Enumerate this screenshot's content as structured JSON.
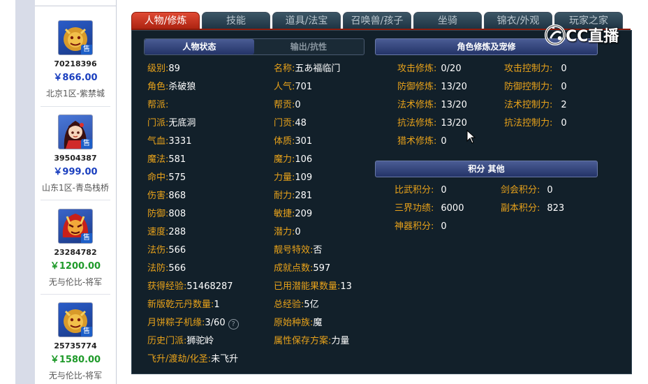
{
  "listings": [
    {
      "id": "70218396",
      "price": "￥866.00",
      "price_color": "#1a3fbf",
      "server": "北京1区-紫禁城",
      "sale_label": "售",
      "avatar": "lion-monster-avatar"
    },
    {
      "id": "39504387",
      "price": "￥999.00",
      "price_color": "#1a3fbf",
      "server": "山东1区-青岛栈桥",
      "sale_label": "售",
      "avatar": "girl-character-avatar"
    },
    {
      "id": "23284782",
      "price": "￥1200.00",
      "price_color": "#1f9a2a",
      "server": "无与伦比-将军",
      "sale_label": "售",
      "avatar": "red-demon-avatar"
    },
    {
      "id": "25735774",
      "price": "￥1580.00",
      "price_color": "#1f9a2a",
      "server": "无与伦比-将军",
      "sale_label": "售",
      "avatar": "lion-monster-avatar"
    }
  ],
  "tabs": [
    {
      "label": "人物/修炼",
      "active": true
    },
    {
      "label": "技能"
    },
    {
      "label": "道具/法宝"
    },
    {
      "label": "召唤兽/孩子"
    },
    {
      "label": "坐骑"
    },
    {
      "label": "锦衣/外观"
    },
    {
      "label": "玩家之家"
    }
  ],
  "status_panel": {
    "header_active": "人物状态",
    "header_inactive": "输出/抗性",
    "left_col": [
      {
        "label": "级别:",
        "value": "89"
      },
      {
        "label": "角色:",
        "value": "杀破狼"
      },
      {
        "label": "帮派:",
        "value": ""
      },
      {
        "label": "门派:",
        "value": "无底洞"
      },
      {
        "label": "气血:",
        "value": "3331"
      },
      {
        "label": "魔法:",
        "value": "581"
      },
      {
        "label": "命中:",
        "value": "575"
      },
      {
        "label": "伤害:",
        "value": "868"
      },
      {
        "label": "防御:",
        "value": "808"
      },
      {
        "label": "速度:",
        "value": "288"
      },
      {
        "label": "法伤:",
        "value": "566"
      },
      {
        "label": "法防:",
        "value": "566"
      }
    ],
    "right_col": [
      {
        "label": "名称:",
        "value": "五あ福临门"
      },
      {
        "label": "人气:",
        "value": "701"
      },
      {
        "label": "帮贡:",
        "value": "0"
      },
      {
        "label": "门贡:",
        "value": "48"
      },
      {
        "label": "体质:",
        "value": "301"
      },
      {
        "label": "魔力:",
        "value": "106"
      },
      {
        "label": "力量:",
        "value": "109"
      },
      {
        "label": "耐力:",
        "value": "281"
      },
      {
        "label": "敏捷:",
        "value": "209"
      },
      {
        "label": "潜力:",
        "value": "0"
      },
      {
        "label": "靓号特效:",
        "value": "否"
      },
      {
        "label": "成就点数:",
        "value": "597"
      }
    ],
    "bottom_pairs": [
      {
        "left_label": "获得经验:",
        "left_value": "51468287",
        "right_label": "已用潜能果数量:",
        "right_value": "13"
      },
      {
        "left_label": "新版乾元丹数量:",
        "left_value": "1",
        "right_label": "总经验:",
        "right_value": "5亿"
      },
      {
        "left_label": "月饼粽子机缘:",
        "left_value": "3/60",
        "right_label": "原始种族:",
        "right_value": "魔"
      },
      {
        "left_label": "历史门派:",
        "left_value": "狮驼岭",
        "right_label": "属性保存方案:",
        "right_value": "力量"
      }
    ],
    "info_icon": "question-icon",
    "last_row": {
      "label": "飞升/渡劫/化圣:",
      "value": "未飞升"
    }
  },
  "cultivation_panel": {
    "header": "角色修炼及宠修",
    "rows": [
      {
        "label": "攻击修炼:",
        "value": "0/20",
        "label2": "攻击控制力:",
        "value2": "0"
      },
      {
        "label": "防御修炼:",
        "value": "13/20",
        "label2": "防御控制力:",
        "value2": "0"
      },
      {
        "label": "法术修炼:",
        "value": "13/20",
        "label2": "法术控制力:",
        "value2": "2"
      },
      {
        "label": "抗法修炼:",
        "value": "13/20",
        "label2": "抗法控制力:",
        "value2": "0"
      },
      {
        "label": "猎术修炼:",
        "value": "0"
      }
    ]
  },
  "points_panel": {
    "header": "积分 其他",
    "rows": [
      {
        "label": "比武积分:",
        "value": "0",
        "label2": "剑会积分:",
        "value2": "0"
      },
      {
        "label": "三界功绩:",
        "value": "6000",
        "label2": "副本积分:",
        "value2": "823"
      },
      {
        "label": "神器积分:",
        "value": "0"
      }
    ]
  },
  "watermark": {
    "text": "CC直播",
    "icon": "cc-live-logo-icon"
  },
  "colors": {
    "label": "#e8a21a",
    "value": "#ffffff",
    "panel_bg": "#12202a",
    "active_tab": "#c8321c"
  }
}
